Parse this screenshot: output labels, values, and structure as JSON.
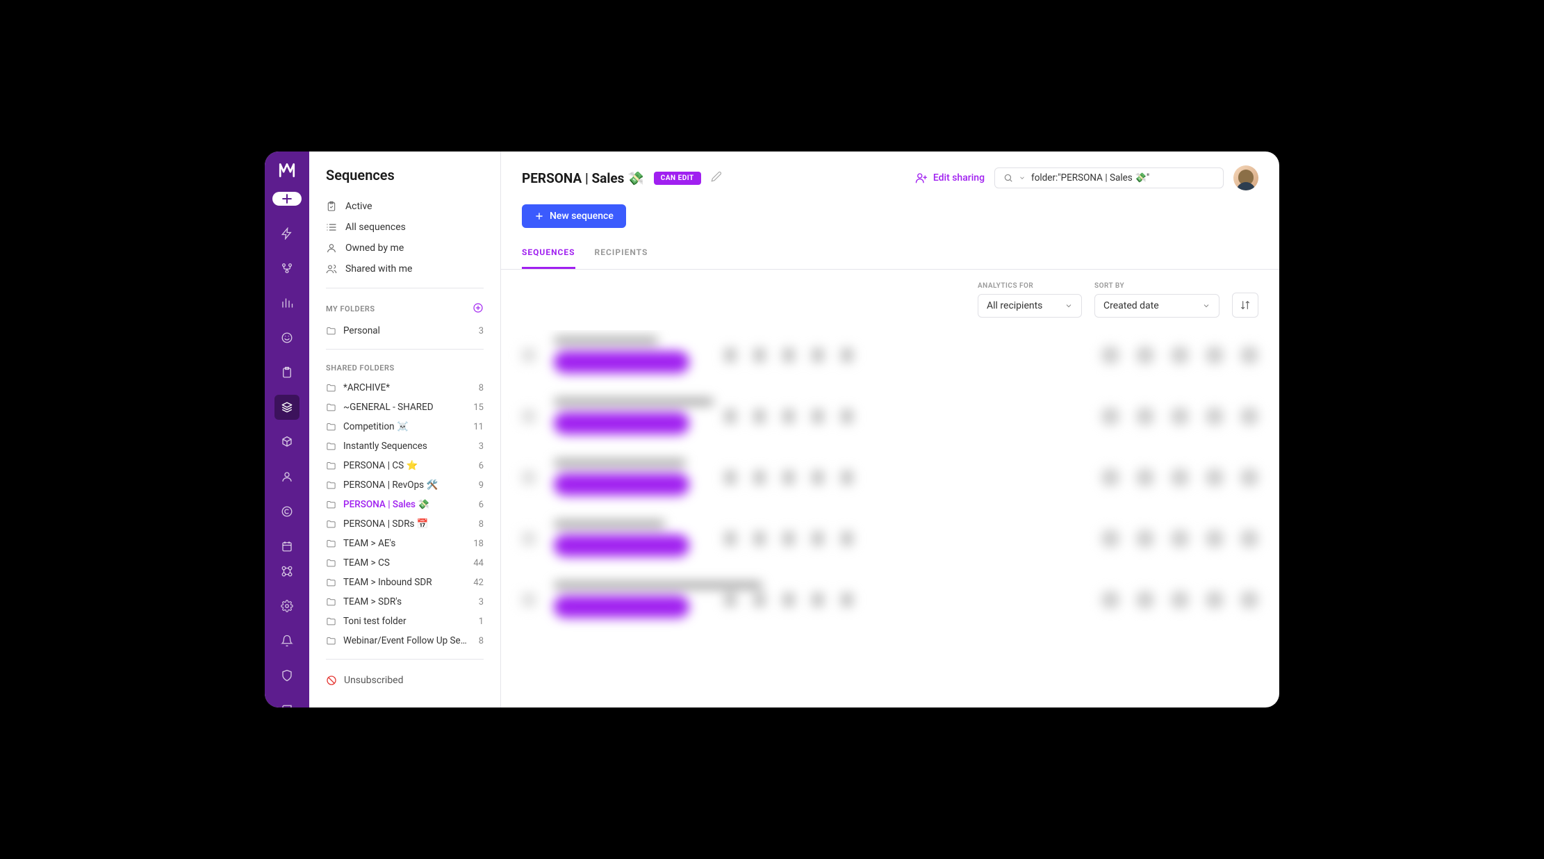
{
  "sidebar": {
    "title": "Sequences",
    "nav": {
      "active": "Active",
      "all": "All sequences",
      "owned": "Owned by me",
      "shared": "Shared with me"
    },
    "my_folders_label": "MY FOLDERS",
    "my_folders": [
      {
        "name": "Personal",
        "count": "3"
      }
    ],
    "shared_folders_label": "SHARED FOLDERS",
    "shared_folders": [
      {
        "name": "*ARCHIVE*",
        "count": "8"
      },
      {
        "name": "~GENERAL - SHARED",
        "count": "15"
      },
      {
        "name": "Competition ☠️",
        "count": "11"
      },
      {
        "name": "Instantly Sequences",
        "count": "3"
      },
      {
        "name": "PERSONA | CS ⭐",
        "count": "6"
      },
      {
        "name": "PERSONA | RevOps 🛠️",
        "count": "9"
      },
      {
        "name": "PERSONA | Sales 💸",
        "count": "6",
        "selected": true
      },
      {
        "name": "PERSONA | SDRs 📅",
        "count": "8"
      },
      {
        "name": "TEAM > AE's",
        "count": "18"
      },
      {
        "name": "TEAM > CS",
        "count": "44"
      },
      {
        "name": "TEAM > Inbound SDR",
        "count": "42"
      },
      {
        "name": "TEAM > SDR's",
        "count": "3"
      },
      {
        "name": "Toni test folder",
        "count": "1"
      },
      {
        "name": "Webinar/Event Follow Up Sequences",
        "count": "8"
      }
    ],
    "unsubscribed": "Unsubscribed"
  },
  "header": {
    "title": "PERSONA | Sales 💸",
    "badge": "CAN EDIT",
    "edit_sharing": "Edit sharing",
    "search_value": "folder:\"PERSONA | Sales 💸\""
  },
  "actions": {
    "new_sequence": "New sequence"
  },
  "tabs": {
    "sequences": "SEQUENCES",
    "recipients": "RECIPIENTS"
  },
  "controls": {
    "analytics_label": "ANALYTICS FOR",
    "analytics_value": "All recipients",
    "sort_label": "SORT BY",
    "sort_value": "Created date"
  },
  "colors": {
    "brand_purple": "#5D1D8E",
    "accent_purple": "#A020F0",
    "primary_blue": "#3B5BFD"
  }
}
